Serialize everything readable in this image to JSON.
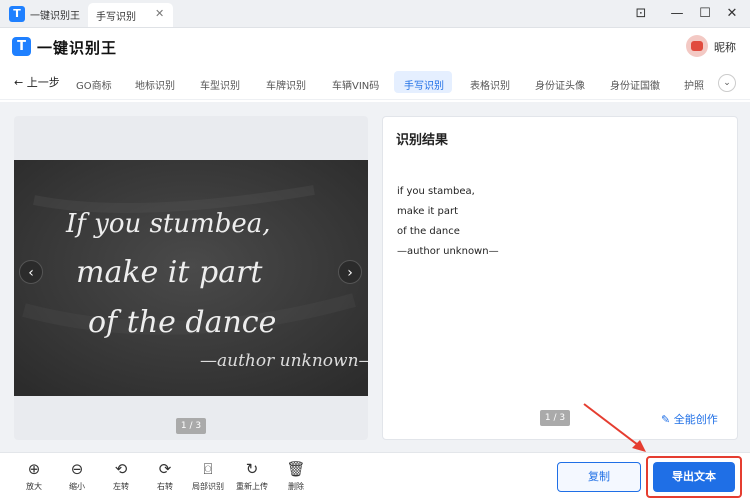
{
  "titlebar": {
    "app_name": "一键识别王",
    "tab_label": "手写识别",
    "tab_close": "✕",
    "pin": "⊡",
    "minimize": "—",
    "maximize": "☐",
    "close": "✕"
  },
  "header": {
    "logo_letter": "T",
    "logo_text": "一键识别王",
    "username": "昵称"
  },
  "nav": {
    "back_label": "← 上一步",
    "items": [
      "GO商标",
      "地标识别",
      "车型识别",
      "车牌识别",
      "车辆VIN码",
      "手写识别",
      "表格识别",
      "身份证头像",
      "身份证国徽",
      "护照"
    ],
    "active_index": 5,
    "more": "⌄"
  },
  "image_viewer": {
    "lines": [
      "If you stumbea,",
      "make it part",
      "of the dance",
      "—author unknown—"
    ],
    "prev": "‹",
    "next": "›",
    "pager": "1 / 3"
  },
  "result": {
    "title": "识别结果",
    "lines": [
      "if you stambea,",
      "make it part",
      "of the dance",
      "—author unknown—"
    ],
    "pager": "1 / 3",
    "create_label": "全能创作"
  },
  "tools": [
    {
      "icon": "zoom-in-icon",
      "glyph": "⊕",
      "label": "放大"
    },
    {
      "icon": "zoom-out-icon",
      "glyph": "⊖",
      "label": "缩小"
    },
    {
      "icon": "rotate-left-icon",
      "glyph": "⟲",
      "label": "左转"
    },
    {
      "icon": "rotate-right-icon",
      "glyph": "⟳",
      "label": "右转"
    },
    {
      "icon": "partial-recognize-icon",
      "glyph": "⌼",
      "label": "局部识别"
    },
    {
      "icon": "reupload-icon",
      "glyph": "↻",
      "label": "重新上传"
    },
    {
      "icon": "delete-icon",
      "glyph": "🗑",
      "label": "删除"
    }
  ],
  "actions": {
    "copy_label": "复制",
    "export_label": "导出文本"
  },
  "colors": {
    "accent": "#1f6fe6",
    "highlight": "#e53d30"
  }
}
